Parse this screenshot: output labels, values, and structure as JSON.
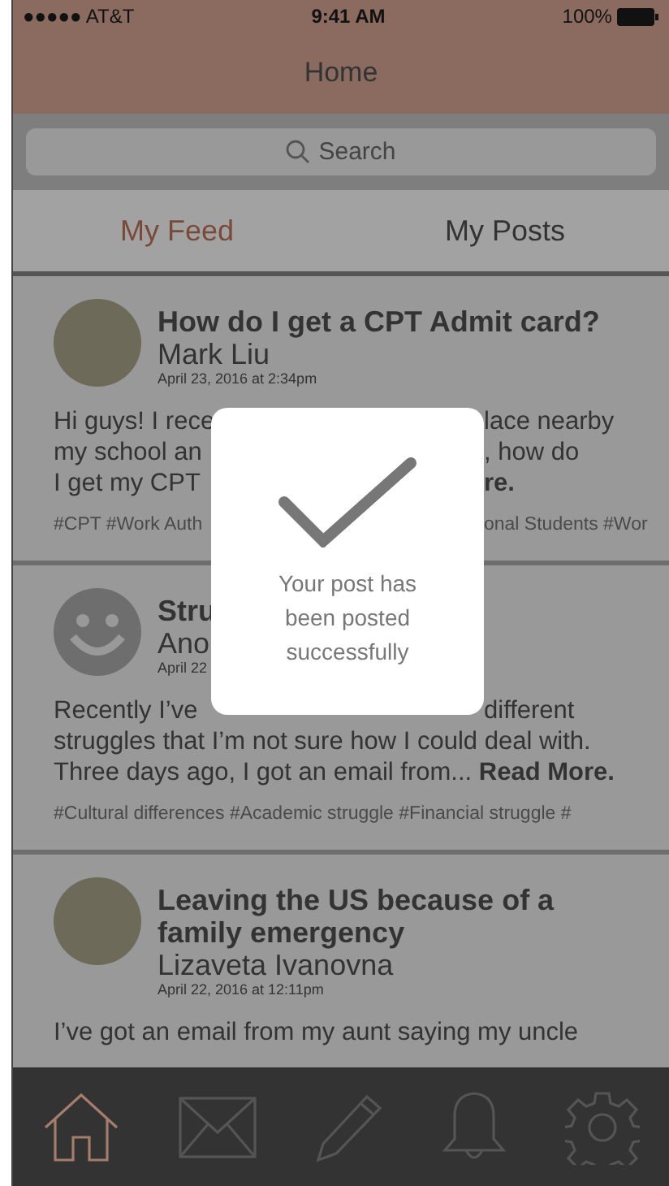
{
  "status_bar": {
    "carrier": "●●●●● AT&T",
    "time": "9:41 AM",
    "battery": "100%"
  },
  "header": {
    "title": "Home"
  },
  "search": {
    "placeholder": "Search"
  },
  "tabs": [
    {
      "label": "My Feed",
      "selected": true
    },
    {
      "label": "My Posts",
      "selected": false
    }
  ],
  "posts": [
    {
      "kind": "photo",
      "title": [
        {
          "left": "How do I get a CPT Admit card?"
        }
      ],
      "author": {
        "left": "Mark Liu"
      },
      "date": {
        "left": "April 23, 2016 at 2:34pm"
      },
      "body": [
        {
          "left": "Hi guys! I rece",
          "right": "lace nearby"
        },
        {
          "left": "my school an",
          "right": ", how do"
        },
        {
          "left": "I get my CPT",
          "right": "**re.**"
        }
      ],
      "tags": {
        "left": "#CPT #Work Auth",
        "right": "onal Students #Wor"
      }
    },
    {
      "kind": "smiley",
      "title": [
        {
          "left": "Stru"
        }
      ],
      "author": {
        "left": "Ano"
      },
      "date": {
        "left": "April 22"
      },
      "body": [
        {
          "left": "Recently I’ve",
          "right": "different"
        },
        {
          "left": "struggles that I’m not sure how I could deal with."
        },
        {
          "left": "Three days ago, I got an email from... **Read More.**"
        }
      ],
      "tags": {
        "left": "#Cultural differences #Academic struggle #Financial struggle #"
      }
    },
    {
      "kind": "photo",
      "title": [
        {
          "left": "Leaving the US because of a"
        },
        {
          "left": "family emergency"
        }
      ],
      "author": {
        "left": "Lizaveta Ivanovna"
      },
      "date": {
        "left": "April 22, 2016 at 12:11pm"
      },
      "body": [
        {
          "left": "I’ve got an email from my aunt saying my uncle"
        }
      ]
    }
  ],
  "modal": {
    "message": "Your post has been posted successfully"
  },
  "tab_bar": [
    {
      "kind": "home",
      "selected": true
    },
    {
      "kind": "mail",
      "selected": false
    },
    {
      "kind": "compose",
      "selected": false
    },
    {
      "kind": "bell",
      "selected": false
    },
    {
      "kind": "settings",
      "selected": false
    }
  ]
}
